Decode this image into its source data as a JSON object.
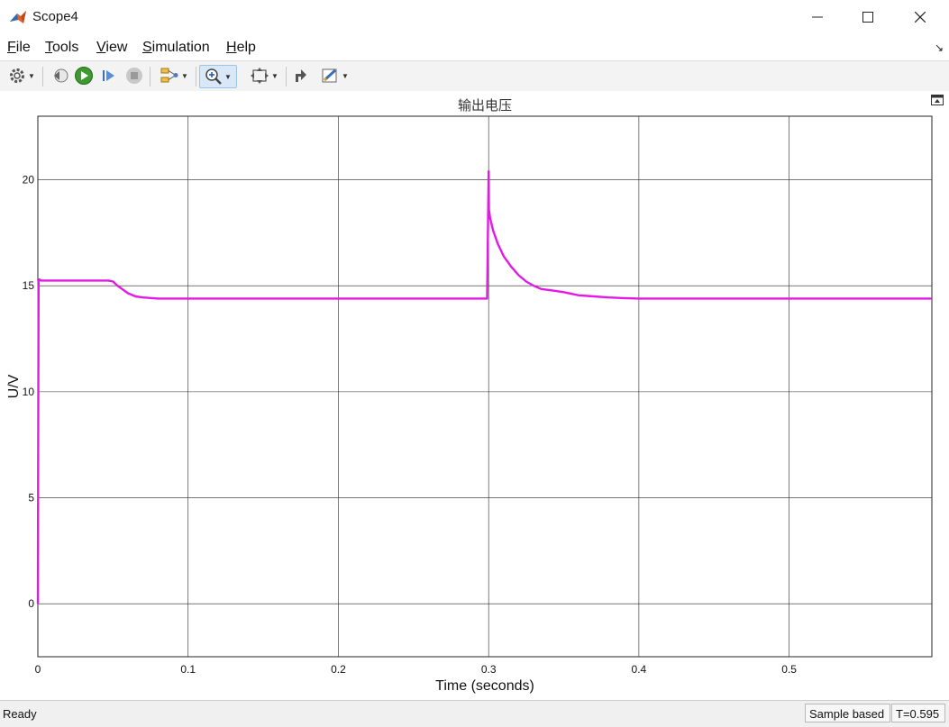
{
  "window": {
    "title": "Scope4",
    "app_icon": "matlab-icon",
    "controls": [
      "minimize-icon",
      "maximize-icon",
      "close-icon"
    ]
  },
  "menu": {
    "items": [
      {
        "label": "File",
        "mnemonic": "F"
      },
      {
        "label": "Tools",
        "mnemonic": "T"
      },
      {
        "label": "View",
        "mnemonic": "V"
      },
      {
        "label": "Simulation",
        "mnemonic": "S"
      },
      {
        "label": "Help",
        "mnemonic": "H"
      }
    ],
    "overflow_icon": "dock-arrow-icon"
  },
  "toolbar": {
    "buttons": [
      "gear-icon",
      "step-back-icon",
      "run-icon",
      "step-forward-icon",
      "stop-icon",
      "signal-select-icon",
      "zoom-in-icon",
      "autoscale-icon",
      "highlight-block-icon",
      "style-icon"
    ],
    "active": "zoom-in-icon"
  },
  "chart_data": {
    "type": "line",
    "title": "输出电压",
    "xlabel": "Time (seconds)",
    "ylabel": "U/V",
    "xlim": [
      0,
      0.595
    ],
    "ylim": [
      -2.5,
      23
    ],
    "xticks": [
      0,
      0.1,
      0.2,
      0.3,
      0.4,
      0.5
    ],
    "yticks": [
      0,
      5,
      10,
      15,
      20
    ],
    "grid": true,
    "line_color": "#e319e6",
    "series": [
      {
        "x": [
          0,
          0.0005,
          0.001,
          0.002,
          0.01,
          0.02,
          0.03,
          0.04,
          0.047,
          0.05,
          0.053,
          0.056,
          0.06,
          0.065,
          0.07,
          0.08,
          0.1,
          0.15,
          0.2,
          0.25,
          0.299,
          0.3,
          0.3002,
          0.301,
          0.303,
          0.306,
          0.31,
          0.315,
          0.32,
          0.325,
          0.33,
          0.335,
          0.34,
          0.345,
          0.35,
          0.36,
          0.37,
          0.38,
          0.39,
          0.4,
          0.45,
          0.5,
          0.55,
          0.595
        ],
        "y": [
          0,
          15.2,
          15.3,
          15.25,
          15.25,
          15.25,
          15.25,
          15.25,
          15.25,
          15.2,
          15.0,
          14.85,
          14.65,
          14.5,
          14.45,
          14.4,
          14.4,
          14.4,
          14.4,
          14.4,
          14.4,
          20.4,
          18.6,
          18.2,
          17.6,
          17.0,
          16.4,
          15.9,
          15.5,
          15.2,
          15.0,
          14.85,
          14.8,
          14.75,
          14.7,
          14.55,
          14.5,
          14.45,
          14.42,
          14.4,
          14.4,
          14.4,
          14.4,
          14.4
        ]
      }
    ]
  },
  "status": {
    "ready": "Ready",
    "mode": "Sample based",
    "time": "T=0.595"
  }
}
